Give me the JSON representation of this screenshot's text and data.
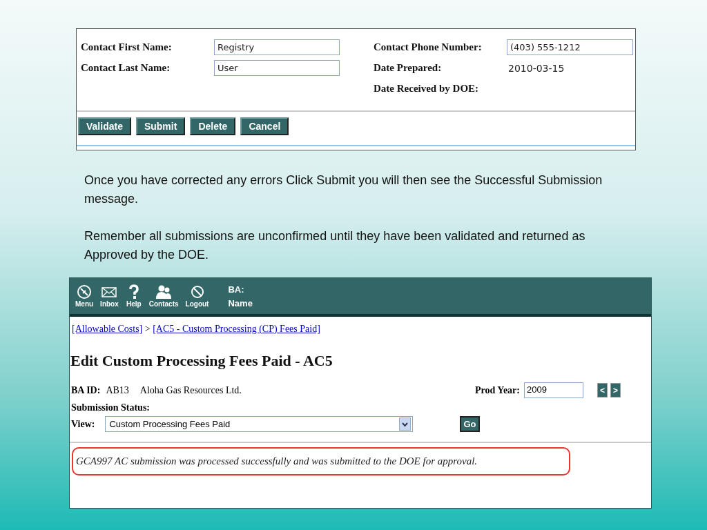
{
  "contact_form": {
    "left_fields": [
      {
        "label": "Contact First Name:",
        "value": "Registry"
      },
      {
        "label": "Contact Last Name:",
        "value": "User"
      }
    ],
    "right_fields": [
      {
        "label": "Contact Phone Number:",
        "kind": "input",
        "value": "(403) 555-1212"
      },
      {
        "label": "Date Prepared:",
        "kind": "text",
        "value": "2010-03-15"
      },
      {
        "label": "Date Received by DOE:",
        "kind": "text"
      }
    ],
    "buttons": [
      "Validate",
      "Submit",
      "Delete",
      "Cancel"
    ]
  },
  "paragraphs": [
    "Once you have corrected any errors Click Submit you will then see the Successful Submission message.",
    "Remember all submissions are unconfirmed until they have been validated and returned as Approved by the DOE."
  ],
  "app": {
    "toolbar": [
      {
        "label": "Menu",
        "kind": "compass"
      },
      {
        "label": "Inbox",
        "kind": "mail"
      },
      {
        "label": "Help",
        "kind": "question"
      },
      {
        "label": "Contacts",
        "kind": "people"
      },
      {
        "label": "Logout",
        "kind": "prohibit"
      }
    ],
    "header_labels": [
      "BA:",
      "Name"
    ],
    "breadcrumb": [
      "[Allowable Costs]",
      "[AC5 - Custom Processing (CP) Fees Paid]"
    ],
    "breadcrumb_separator": ">",
    "title": "Edit Custom Processing Fees Paid - AC5",
    "ba_id_label": "BA ID:",
    "ba_id": "AB13",
    "company": "Aloha Gas Resources Ltd.",
    "prod_year_label": "Prod Year:",
    "prod_year": "2009",
    "year_nav": [
      "<",
      ">"
    ],
    "submission_status_label": "Submission Status:",
    "view_label": "View:",
    "view_value": "Custom Processing Fees Paid",
    "go_button": "Go",
    "message": "GCA997 AC submission was processed successfully and was submitted to the DOE for approval."
  }
}
